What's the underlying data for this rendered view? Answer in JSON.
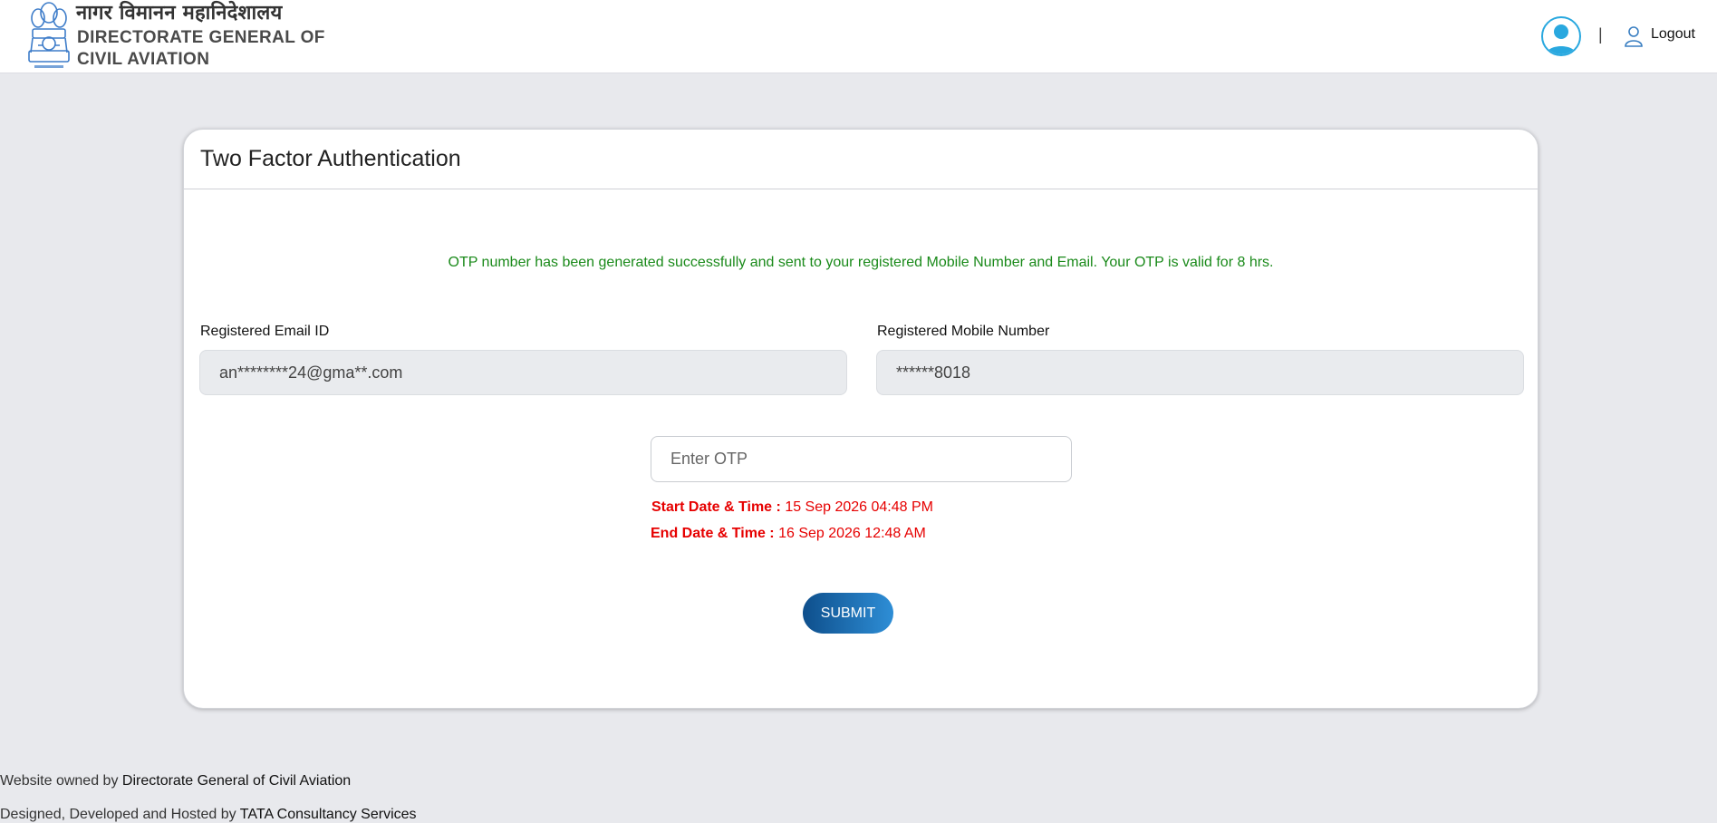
{
  "header": {
    "brand_hindi": "नागर विमानन महानिदेशालय",
    "brand_english": "DIRECTORATE GENERAL OF CIVIL AVIATION",
    "separator": "|",
    "logout_label": "Logout"
  },
  "card": {
    "title": "Two Factor Authentication",
    "otp_message": "OTP number has been generated successfully and sent to your registered Mobile Number and Email. Your OTP is valid for 8 hrs.",
    "email": {
      "label": "Registered Email ID",
      "value": "an********24@gma**.com"
    },
    "mobile": {
      "label": "Registered Mobile Number",
      "value": "******8018"
    },
    "otp_placeholder": "Enter OTP",
    "start": {
      "label": "Start Date & Time :",
      "value": "15 Sep 2026 04:48 PM"
    },
    "end": {
      "label": "End Date & Time :",
      "value": "16 Sep 2026 12:48 AM"
    },
    "submit_label": "SUBMIT"
  },
  "footer": {
    "owned_prefix": "Website owned by",
    "owned_link": "Directorate General of Civil Aviation",
    "designed_prefix": "Designed, Developed and Hosted by",
    "designed_link": "TATA Consultancy Services"
  },
  "colors": {
    "success": "#1a8a1a",
    "error": "#e60000",
    "primary": "#1d6fb5",
    "avatar": "#29a8df"
  }
}
